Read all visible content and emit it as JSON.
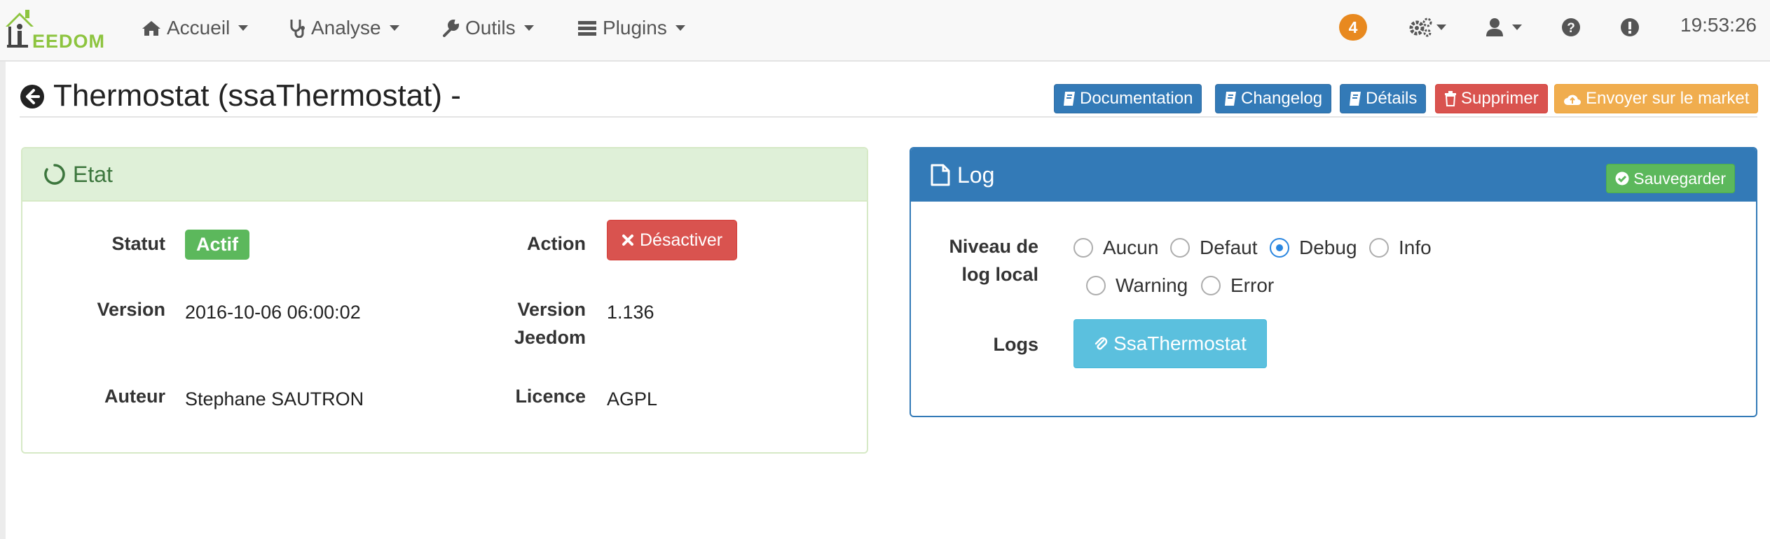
{
  "brand": {
    "logo_text": "EEDOM",
    "logo_color": "#8dc43f"
  },
  "nav": {
    "items": [
      {
        "label": "Accueil",
        "icon": "home-icon"
      },
      {
        "label": "Analyse",
        "icon": "stethoscope-icon"
      },
      {
        "label": "Outils",
        "icon": "wrench-icon"
      },
      {
        "label": "Plugins",
        "icon": "plugins-icon"
      }
    ],
    "notification_count": "4",
    "right_icons": [
      "cogs-icon",
      "user-icon",
      "help-icon",
      "alert-icon"
    ],
    "clock": "19:53:26"
  },
  "header": {
    "title": "Thermostat (ssaThermostat) -",
    "buttons": {
      "documentation": "Documentation",
      "changelog": "Changelog",
      "details": "Détails",
      "delete": "Supprimer",
      "market": "Envoyer sur le market"
    }
  },
  "etat": {
    "title": "Etat",
    "statut_label": "Statut",
    "statut_value": "Actif",
    "action_label": "Action",
    "action_button": "Désactiver",
    "version_label": "Version",
    "version_value": "2016-10-06 06:00:02",
    "version_jeedom_label_1": "Version",
    "version_jeedom_label_2": "Jeedom",
    "version_jeedom_value": "1.136",
    "auteur_label": "Auteur",
    "auteur_value": "Stephane SAUTRON",
    "licence_label": "Licence",
    "licence_value": "AGPL"
  },
  "log": {
    "title": "Log",
    "save_button": "Sauvegarder",
    "level_label_1": "Niveau de",
    "level_label_2": "log local",
    "levels": [
      "Aucun",
      "Defaut",
      "Debug",
      "Info",
      "Warning",
      "Error"
    ],
    "selected_level": "Debug",
    "logs_label": "Logs",
    "logs_button": "SsaThermostat"
  }
}
